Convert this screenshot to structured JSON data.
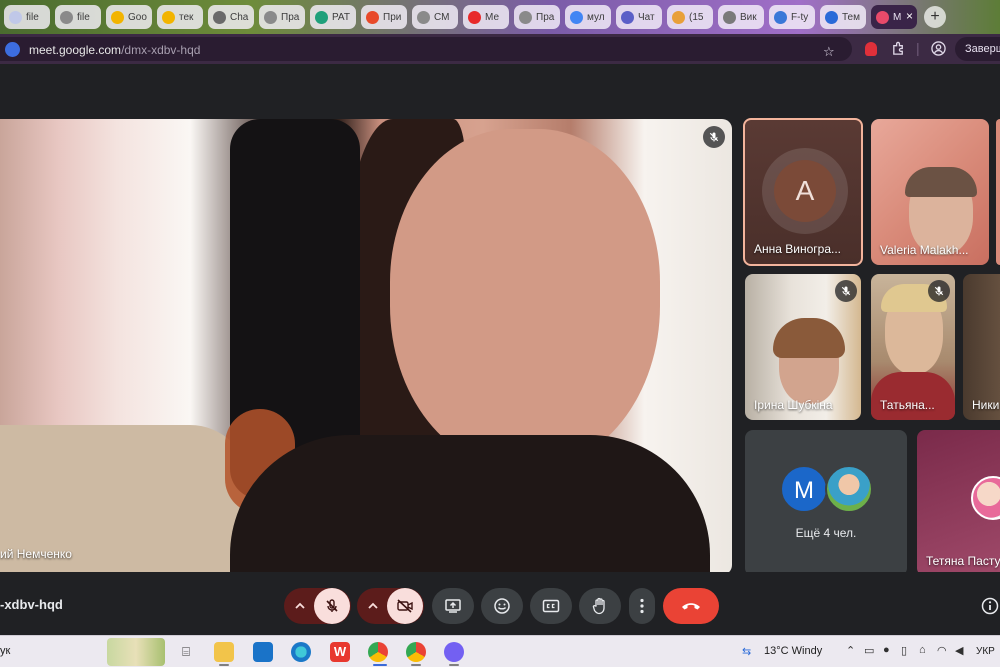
{
  "browser": {
    "tabs": [
      {
        "label": "file",
        "color": "#c0c8e8"
      },
      {
        "label": "file",
        "color": "#8a8a8a"
      },
      {
        "label": "Goo",
        "color": "#f2b400"
      },
      {
        "label": "тек",
        "color": "#f2b400"
      },
      {
        "label": "Cha",
        "color": "#6a6a6a"
      },
      {
        "label": "Пра",
        "color": "#8a8a8a"
      },
      {
        "label": "PAT",
        "color": "#1fa07a"
      },
      {
        "label": "При",
        "color": "#e84a2a"
      },
      {
        "label": "СМ",
        "color": "#8a8a8a"
      },
      {
        "label": "Ме",
        "color": "#e82a2a"
      },
      {
        "label": "Пра",
        "color": "#8a8a8a"
      },
      {
        "label": "мул",
        "color": "#4285f4"
      },
      {
        "label": "Чат",
        "color": "#5b5fc7"
      },
      {
        "label": "(15",
        "color": "#e8a03a"
      },
      {
        "label": "Вик",
        "color": "#7a7a7a"
      },
      {
        "label": "F-ty",
        "color": "#3a78d8"
      },
      {
        "label": "Тем",
        "color": "#2a6ad8"
      },
      {
        "label": "M",
        "color": "#e84a6a",
        "active": true
      }
    ],
    "new_tab": "+",
    "url_host": "meet.google.com",
    "url_path": "/dmx-xdbv-hqd",
    "finish_label": "Заверши"
  },
  "meet": {
    "main_speaker": "ий Немченко",
    "participants": [
      {
        "name": "Анна Виногра...",
        "initial": "A"
      },
      {
        "name": "Valeria Malakh..."
      },
      {
        "name": "Ірина Шубкіна"
      },
      {
        "name": "Татьяна..."
      },
      {
        "name": "Ники"
      },
      {
        "name": "Тетяна Пасту"
      }
    ],
    "more": {
      "initial": "M",
      "label": "Ещё 4 чел."
    },
    "meeting_code": "-xdbv-hqd"
  },
  "taskbar": {
    "search_tail": "ук",
    "weather": "13°C  Windy",
    "language": "УКР"
  }
}
